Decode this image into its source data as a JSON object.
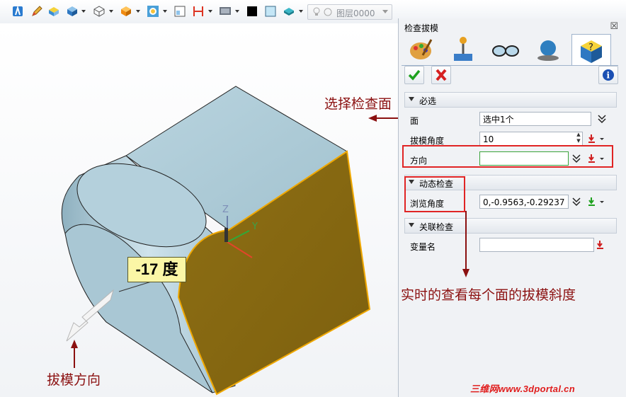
{
  "toolbar": {
    "icons": [
      "sketch-icon",
      "pencil-icon",
      "face-shaded-icon",
      "solid-box-icon",
      "wireframe-box-icon",
      "orange-cube-icon",
      "target-view-icon",
      "grid-view-icon",
      "measure-icon",
      "display-mode-icon",
      "black-color-icon",
      "light-blue-color-icon",
      "teal-layer-icon"
    ],
    "layer_label": "图层0000"
  },
  "panel": {
    "title": "检查拔模",
    "close_symbol": "☒",
    "tabs": [
      "palette-icon",
      "joystick-icon",
      "glasses-icon",
      "globe-icon",
      "help-cube-icon"
    ],
    "required_section": "必选",
    "face_label": "面",
    "face_value": "选中1个",
    "draft_angle_label": "拔模角度",
    "draft_angle_value": "10",
    "direction_label": "方向",
    "direction_value": "",
    "dynamic_section": "动态检查",
    "browse_angle_label": "浏览角度",
    "browse_angle_value": "0,-0.9563,-0.29237",
    "linked_section": "关联检查",
    "variable_label": "变量名",
    "variable_value": ""
  },
  "annotations": {
    "select_face": "选择检查面",
    "realtime": "实时的查看每个面的拔模斜度",
    "draft_direction": "拔模方向",
    "degree_label": "-17 度"
  },
  "axes": {
    "z": "Z",
    "y": "Y"
  },
  "watermark": "三维网www.3dportal.cn",
  "colors": {
    "model": "#a9c8d5",
    "selected_face": "#8a6a12",
    "highlight_edge": "#f0a800",
    "annotation": "#8b1010",
    "red_box": "#e02424"
  }
}
